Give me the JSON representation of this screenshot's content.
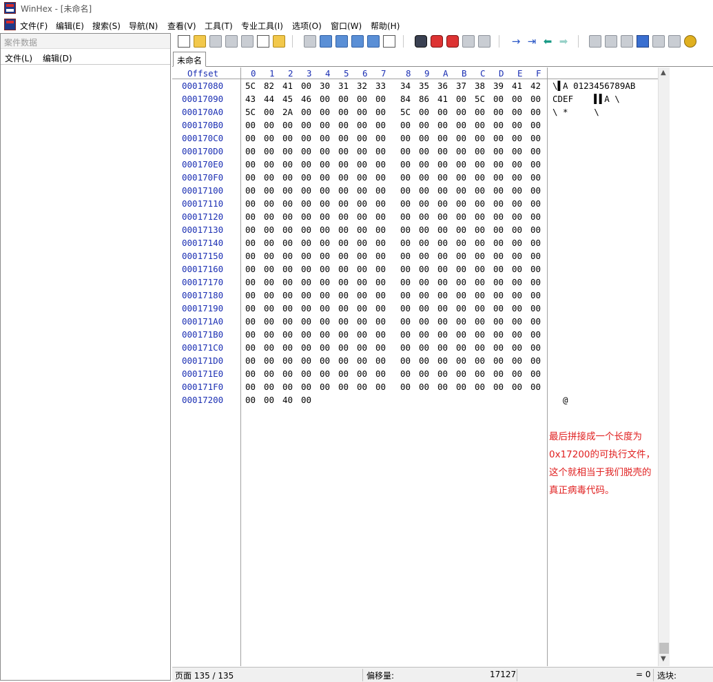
{
  "window": {
    "title": "WinHex - [未命名]"
  },
  "menubar": [
    "文件(F)",
    "编辑(E)",
    "搜索(S)",
    "导航(N)",
    "查看(V)",
    "工具(T)",
    "专业工具(I)",
    "选项(O)",
    "窗口(W)",
    "帮助(H)"
  ],
  "left_panel": {
    "header": "案件数据",
    "menu": [
      "文件(L)",
      "编辑(D)"
    ]
  },
  "toolbar": {
    "icons": [
      "new-file-icon",
      "open-folder-icon",
      "save-icon",
      "print-icon",
      "properties-icon",
      "run-icon",
      "undo-icon",
      "copy-block-icon",
      "clipboard-icon",
      "paste-icon",
      "write-icon",
      "binary-convert-icon",
      "find-text-icon",
      "find-hex-icon",
      "find-hex-value-icon",
      "replace-text-icon",
      "replace-hex-icon",
      "goto-offset-icon",
      "goto-sector-icon",
      "back-arrow-icon",
      "forward-arrow-icon",
      "open-disk-icon",
      "disk-editor-icon",
      "ram-editor-icon",
      "calculator-icon",
      "search-magnifier-icon",
      "hash-icon",
      "gear-icon"
    ]
  },
  "tabs": [
    "未命名"
  ],
  "hex": {
    "offset_label": "Offset",
    "columns": [
      "0",
      "1",
      "2",
      "3",
      "4",
      "5",
      "6",
      "7",
      "8",
      "9",
      "A",
      "B",
      "C",
      "D",
      "E",
      "F"
    ],
    "rows": [
      {
        "offset": "00017080",
        "bytes": [
          "5C",
          "82",
          "41",
          "00",
          "30",
          "31",
          "32",
          "33",
          "34",
          "35",
          "36",
          "37",
          "38",
          "39",
          "41",
          "42"
        ],
        "text": "\\▌A 0123456789AB"
      },
      {
        "offset": "00017090",
        "bytes": [
          "43",
          "44",
          "45",
          "46",
          "00",
          "00",
          "00",
          "00",
          "84",
          "86",
          "41",
          "00",
          "5C",
          "00",
          "00",
          "00"
        ],
        "text": "CDEF    ▌▌A \\"
      },
      {
        "offset": "000170A0",
        "bytes": [
          "5C",
          "00",
          "2A",
          "00",
          "00",
          "00",
          "00",
          "00",
          "5C",
          "00",
          "00",
          "00",
          "00",
          "00",
          "00",
          "00"
        ],
        "text": "\\ *     \\"
      },
      {
        "offset": "000170B0",
        "bytes": [
          "00",
          "00",
          "00",
          "00",
          "00",
          "00",
          "00",
          "00",
          "00",
          "00",
          "00",
          "00",
          "00",
          "00",
          "00",
          "00"
        ],
        "text": ""
      },
      {
        "offset": "000170C0",
        "bytes": [
          "00",
          "00",
          "00",
          "00",
          "00",
          "00",
          "00",
          "00",
          "00",
          "00",
          "00",
          "00",
          "00",
          "00",
          "00",
          "00"
        ],
        "text": ""
      },
      {
        "offset": "000170D0",
        "bytes": [
          "00",
          "00",
          "00",
          "00",
          "00",
          "00",
          "00",
          "00",
          "00",
          "00",
          "00",
          "00",
          "00",
          "00",
          "00",
          "00"
        ],
        "text": ""
      },
      {
        "offset": "000170E0",
        "bytes": [
          "00",
          "00",
          "00",
          "00",
          "00",
          "00",
          "00",
          "00",
          "00",
          "00",
          "00",
          "00",
          "00",
          "00",
          "00",
          "00"
        ],
        "text": ""
      },
      {
        "offset": "000170F0",
        "bytes": [
          "00",
          "00",
          "00",
          "00",
          "00",
          "00",
          "00",
          "00",
          "00",
          "00",
          "00",
          "00",
          "00",
          "00",
          "00",
          "00"
        ],
        "text": ""
      },
      {
        "offset": "00017100",
        "bytes": [
          "00",
          "00",
          "00",
          "00",
          "00",
          "00",
          "00",
          "00",
          "00",
          "00",
          "00",
          "00",
          "00",
          "00",
          "00",
          "00"
        ],
        "text": ""
      },
      {
        "offset": "00017110",
        "bytes": [
          "00",
          "00",
          "00",
          "00",
          "00",
          "00",
          "00",
          "00",
          "00",
          "00",
          "00",
          "00",
          "00",
          "00",
          "00",
          "00"
        ],
        "text": ""
      },
      {
        "offset": "00017120",
        "bytes": [
          "00",
          "00",
          "00",
          "00",
          "00",
          "00",
          "00",
          "00",
          "00",
          "00",
          "00",
          "00",
          "00",
          "00",
          "00",
          "00"
        ],
        "text": ""
      },
      {
        "offset": "00017130",
        "bytes": [
          "00",
          "00",
          "00",
          "00",
          "00",
          "00",
          "00",
          "00",
          "00",
          "00",
          "00",
          "00",
          "00",
          "00",
          "00",
          "00"
        ],
        "text": ""
      },
      {
        "offset": "00017140",
        "bytes": [
          "00",
          "00",
          "00",
          "00",
          "00",
          "00",
          "00",
          "00",
          "00",
          "00",
          "00",
          "00",
          "00",
          "00",
          "00",
          "00"
        ],
        "text": ""
      },
      {
        "offset": "00017150",
        "bytes": [
          "00",
          "00",
          "00",
          "00",
          "00",
          "00",
          "00",
          "00",
          "00",
          "00",
          "00",
          "00",
          "00",
          "00",
          "00",
          "00"
        ],
        "text": ""
      },
      {
        "offset": "00017160",
        "bytes": [
          "00",
          "00",
          "00",
          "00",
          "00",
          "00",
          "00",
          "00",
          "00",
          "00",
          "00",
          "00",
          "00",
          "00",
          "00",
          "00"
        ],
        "text": ""
      },
      {
        "offset": "00017170",
        "bytes": [
          "00",
          "00",
          "00",
          "00",
          "00",
          "00",
          "00",
          "00",
          "00",
          "00",
          "00",
          "00",
          "00",
          "00",
          "00",
          "00"
        ],
        "text": ""
      },
      {
        "offset": "00017180",
        "bytes": [
          "00",
          "00",
          "00",
          "00",
          "00",
          "00",
          "00",
          "00",
          "00",
          "00",
          "00",
          "00",
          "00",
          "00",
          "00",
          "00"
        ],
        "text": ""
      },
      {
        "offset": "00017190",
        "bytes": [
          "00",
          "00",
          "00",
          "00",
          "00",
          "00",
          "00",
          "00",
          "00",
          "00",
          "00",
          "00",
          "00",
          "00",
          "00",
          "00"
        ],
        "text": ""
      },
      {
        "offset": "000171A0",
        "bytes": [
          "00",
          "00",
          "00",
          "00",
          "00",
          "00",
          "00",
          "00",
          "00",
          "00",
          "00",
          "00",
          "00",
          "00",
          "00",
          "00"
        ],
        "text": ""
      },
      {
        "offset": "000171B0",
        "bytes": [
          "00",
          "00",
          "00",
          "00",
          "00",
          "00",
          "00",
          "00",
          "00",
          "00",
          "00",
          "00",
          "00",
          "00",
          "00",
          "00"
        ],
        "text": ""
      },
      {
        "offset": "000171C0",
        "bytes": [
          "00",
          "00",
          "00",
          "00",
          "00",
          "00",
          "00",
          "00",
          "00",
          "00",
          "00",
          "00",
          "00",
          "00",
          "00",
          "00"
        ],
        "text": ""
      },
      {
        "offset": "000171D0",
        "bytes": [
          "00",
          "00",
          "00",
          "00",
          "00",
          "00",
          "00",
          "00",
          "00",
          "00",
          "00",
          "00",
          "00",
          "00",
          "00",
          "00"
        ],
        "text": ""
      },
      {
        "offset": "000171E0",
        "bytes": [
          "00",
          "00",
          "00",
          "00",
          "00",
          "00",
          "00",
          "00",
          "00",
          "00",
          "00",
          "00",
          "00",
          "00",
          "00",
          "00"
        ],
        "text": ""
      },
      {
        "offset": "000171F0",
        "bytes": [
          "00",
          "00",
          "00",
          "00",
          "00",
          "00",
          "00",
          "00",
          "00",
          "00",
          "00",
          "00",
          "00",
          "00",
          "00",
          "00"
        ],
        "text": ""
      },
      {
        "offset": "00017200",
        "bytes": [
          "00",
          "00",
          "40",
          "00"
        ],
        "text": "  @"
      }
    ]
  },
  "annotation": "最后拼接成一个长度为0x17200的可执行文件，这个就相当于我们脱壳的真正病毒代码。",
  "statusbar": {
    "page": "页面 135 / 135",
    "offset_label": "偏移量:",
    "offset_value": "17127",
    "value": "= 0",
    "selection_label": "选块:"
  }
}
